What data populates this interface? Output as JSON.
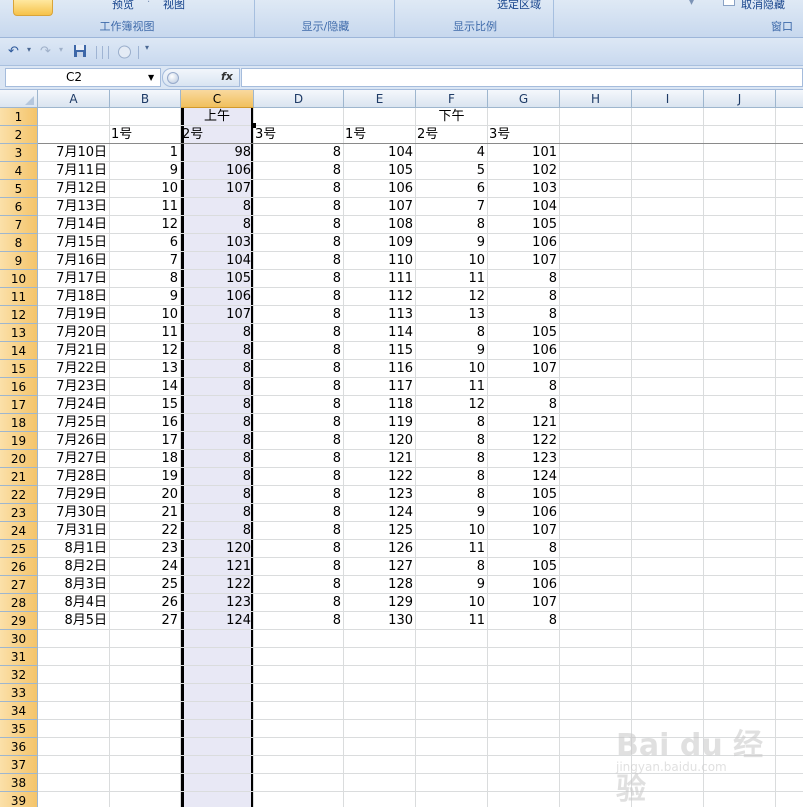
{
  "ribbon": {
    "preview_label": "预览",
    "view_label": "视图",
    "selected_area_label": "选定区域",
    "unhide_label": "取消隐藏",
    "groups": {
      "workbook_views": "工作簿视图",
      "show_hide": "显示/隐藏",
      "zoom": "显示比例",
      "window": "窗口"
    }
  },
  "formula_bar": {
    "name_box": "C2",
    "fx_label": "fx",
    "formula": ""
  },
  "grid": {
    "columns": [
      "A",
      "B",
      "C",
      "D",
      "E",
      "F",
      "G",
      "H",
      "I",
      "J"
    ],
    "selected_column": "C",
    "rows": [
      "1",
      "2",
      "3",
      "4",
      "5",
      "6",
      "7",
      "8",
      "9",
      "10",
      "11",
      "12",
      "13",
      "14",
      "15",
      "16",
      "17",
      "18",
      "19",
      "20",
      "21",
      "22",
      "23",
      "24",
      "25",
      "26",
      "27",
      "28",
      "29",
      "30",
      "31",
      "32",
      "33",
      "34",
      "35",
      "36",
      "37",
      "38",
      "39"
    ],
    "header_row1": {
      "morning": "上午",
      "afternoon": "下午"
    },
    "header_row2": {
      "b": "1号",
      "c": "2号",
      "d": "3号",
      "e": "1号",
      "f": "2号",
      "g": "3号"
    },
    "data": [
      [
        "7月10日",
        "1",
        "98",
        "8",
        "104",
        "4",
        "101"
      ],
      [
        "7月11日",
        "9",
        "106",
        "8",
        "105",
        "5",
        "102"
      ],
      [
        "7月12日",
        "10",
        "107",
        "8",
        "106",
        "6",
        "103"
      ],
      [
        "7月13日",
        "11",
        "8",
        "8",
        "107",
        "7",
        "104"
      ],
      [
        "7月14日",
        "12",
        "8",
        "8",
        "108",
        "8",
        "105"
      ],
      [
        "7月15日",
        "6",
        "103",
        "8",
        "109",
        "9",
        "106"
      ],
      [
        "7月16日",
        "7",
        "104",
        "8",
        "110",
        "10",
        "107"
      ],
      [
        "7月17日",
        "8",
        "105",
        "8",
        "111",
        "11",
        "8"
      ],
      [
        "7月18日",
        "9",
        "106",
        "8",
        "112",
        "12",
        "8"
      ],
      [
        "7月19日",
        "10",
        "107",
        "8",
        "113",
        "13",
        "8"
      ],
      [
        "7月20日",
        "11",
        "8",
        "8",
        "114",
        "8",
        "105"
      ],
      [
        "7月21日",
        "12",
        "8",
        "8",
        "115",
        "9",
        "106"
      ],
      [
        "7月22日",
        "13",
        "8",
        "8",
        "116",
        "10",
        "107"
      ],
      [
        "7月23日",
        "14",
        "8",
        "8",
        "117",
        "11",
        "8"
      ],
      [
        "7月24日",
        "15",
        "8",
        "8",
        "118",
        "12",
        "8"
      ],
      [
        "7月25日",
        "16",
        "8",
        "8",
        "119",
        "8",
        "121"
      ],
      [
        "7月26日",
        "17",
        "8",
        "8",
        "120",
        "8",
        "122"
      ],
      [
        "7月27日",
        "18",
        "8",
        "8",
        "121",
        "8",
        "123"
      ],
      [
        "7月28日",
        "19",
        "8",
        "8",
        "122",
        "8",
        "124"
      ],
      [
        "7月29日",
        "20",
        "8",
        "8",
        "123",
        "8",
        "105"
      ],
      [
        "7月30日",
        "21",
        "8",
        "8",
        "124",
        "9",
        "106"
      ],
      [
        "7月31日",
        "22",
        "8",
        "8",
        "125",
        "10",
        "107"
      ],
      [
        "8月1日",
        "23",
        "120",
        "8",
        "126",
        "11",
        "8"
      ],
      [
        "8月2日",
        "24",
        "121",
        "8",
        "127",
        "8",
        "105"
      ],
      [
        "8月3日",
        "25",
        "122",
        "8",
        "128",
        "9",
        "106"
      ],
      [
        "8月4日",
        "26",
        "123",
        "8",
        "129",
        "10",
        "107"
      ],
      [
        "8月5日",
        "27",
        "124",
        "8",
        "130",
        "11",
        "8"
      ]
    ]
  },
  "watermark": {
    "text": "Bai du 经验",
    "sub": "jingyan.baidu.com"
  }
}
